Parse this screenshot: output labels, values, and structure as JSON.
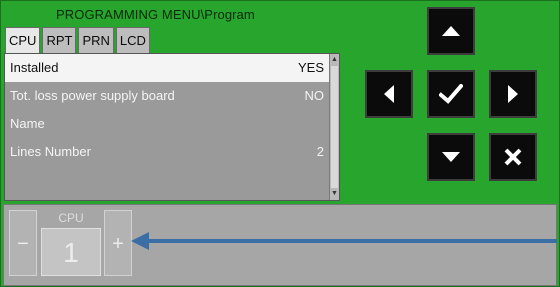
{
  "title": "PROGRAMMING MENU\\Program",
  "tabs": [
    {
      "label": "CPU",
      "active": true
    },
    {
      "label": "RPT",
      "active": false
    },
    {
      "label": "PRN",
      "active": false
    },
    {
      "label": "LCD",
      "active": false
    }
  ],
  "rows": [
    {
      "label": "Installed",
      "value": "YES",
      "selected": true
    },
    {
      "label": "Tot. loss power supply board",
      "value": "NO",
      "selected": false
    },
    {
      "label": "Name",
      "value": "",
      "selected": false
    },
    {
      "label": "Lines Number",
      "value": "2",
      "selected": false
    }
  ],
  "nav": {
    "up": "arrow-up-icon",
    "left": "arrow-left-icon",
    "ok": "checkmark-icon",
    "right": "arrow-right-icon",
    "down": "arrow-down-icon",
    "cancel": "cross-icon"
  },
  "stepper": {
    "caption": "CPU",
    "value": "1",
    "minus": "−",
    "plus": "+"
  },
  "colors": {
    "background": "#27a52c",
    "annotation_arrow": "#3a6ea5"
  }
}
